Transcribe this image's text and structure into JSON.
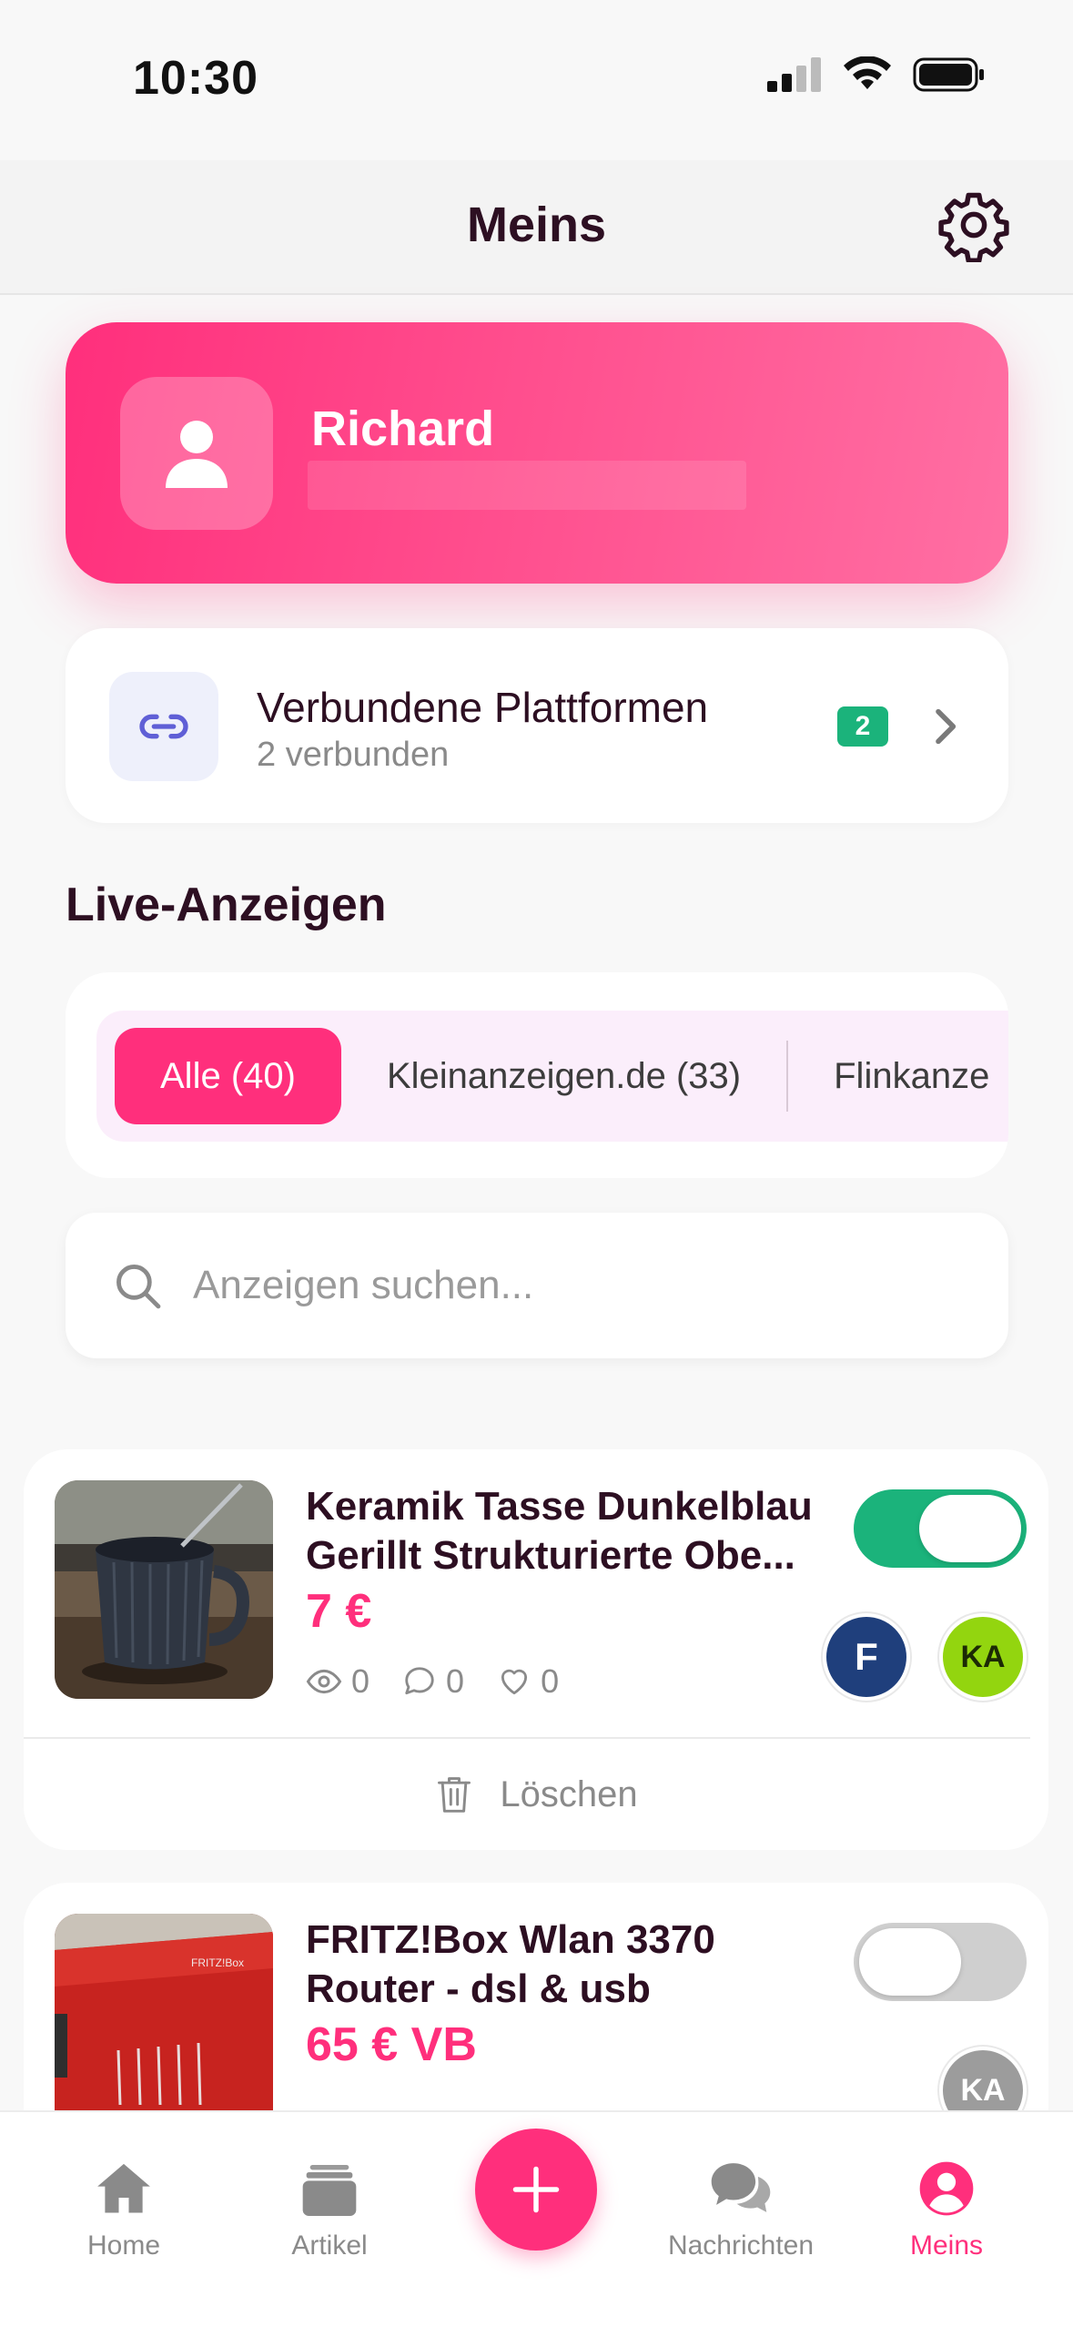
{
  "status_bar": {
    "time": "10:30"
  },
  "header": {
    "title": "Meins"
  },
  "profile": {
    "name": "Richard"
  },
  "platforms": {
    "title": "Verbundene Plattformen",
    "subtitle": "2 verbunden",
    "badge": "2"
  },
  "section": {
    "title": "Live-Anzeigen"
  },
  "filters": [
    {
      "label": "Alle (40)",
      "active": true
    },
    {
      "label": "Kleinanzeigen.de (33)",
      "active": false
    },
    {
      "label": "Flinkanze",
      "active": false
    }
  ],
  "search": {
    "placeholder": "Anzeigen suchen..."
  },
  "listings": [
    {
      "title": "Keramik Tasse Dunkelblau Gerillt Strukturierte Obe...",
      "price": "7 €",
      "views": "0",
      "comments": "0",
      "likes": "0",
      "active": true,
      "platform_badges": [
        "F",
        "KA"
      ],
      "delete_label": "Löschen"
    },
    {
      "title": "FRITZ!Box Wlan 3370 Router - dsl & usb",
      "price": "65 € VB",
      "active": false,
      "platform_badges": [
        "KA"
      ]
    }
  ],
  "colors": {
    "accent": "#ff2f7c",
    "success": "#1bb37b",
    "dark_text": "#2d0f22",
    "muted": "#8a8a8a"
  },
  "tabbar": {
    "items": [
      {
        "label": "Home",
        "icon": "home-icon"
      },
      {
        "label": "Artikel",
        "icon": "stack-icon"
      },
      {
        "label": "",
        "icon": "plus-icon"
      },
      {
        "label": "Nachrichten",
        "icon": "chat-icon"
      },
      {
        "label": "Meins",
        "icon": "user-icon",
        "active": true
      }
    ]
  }
}
